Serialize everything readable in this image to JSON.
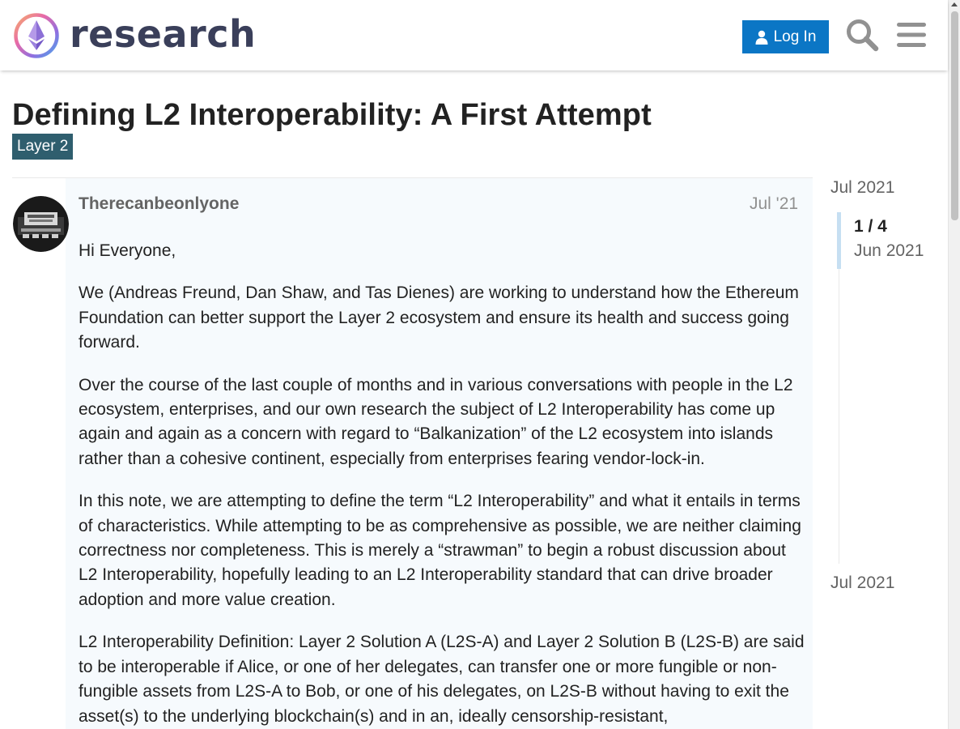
{
  "header": {
    "logo_text": "research",
    "login_label": "Log In",
    "colors": {
      "login_bg": "#0b76c5",
      "logo_text": "#3a3f5a"
    }
  },
  "topic": {
    "title": "Defining L2 Interoperability: A First Attempt",
    "category": "Layer 2",
    "category_color": "#2f5e6e"
  },
  "post": {
    "username": "Therecanbeonlyone",
    "date": "Jul '21",
    "paragraphs": [
      "Hi Everyone,",
      "We (Andreas Freund, Dan Shaw, and Tas Dienes) are working to understand how the Ethereum Foundation can better support the Layer 2 ecosystem and ensure its health and success going forward.",
      "Over the course of the last couple of months and in various conversations with people in the L2 ecosystem, enterprises, and our own research the subject of L2 Interoperability has come up again and again as a concern with regard to “Balkanization” of the L2 ecosystem into islands rather than a cohesive continent, especially from enterprises fearing vendor-lock-in.",
      "In this note, we are attempting to define the term “L2 Interoperability” and what it entails in terms of characteristics. While attempting to be as comprehensive as possible, we are neither claiming correctness nor completeness. This is merely a “strawman” to begin a robust discussion about L2 Interoperability, hopefully leading to an L2 Interoperability standard that can drive broader adoption and more value creation.",
      "L2 Interoperability Definition: Layer 2 Solution A (L2S-A) and Layer 2 Solution B (L2S-B) are said to be interoperable if Alice, or one of her delegates, can transfer one or more fungible or non-fungible assets from L2S-A to Bob, or one of his delegates, on L2S-B without having to exit the asset(s) to the underlying blockchain(s) and in an, ideally censorship-resistant,"
    ]
  },
  "timeline": {
    "top_date": "Jul 2021",
    "position": "1 / 4",
    "current_date": "Jun 2021",
    "bottom_date": "Jul 2021"
  },
  "icons": {
    "logo": "ethereum-research-logo-icon",
    "login": "user-icon",
    "search": "search-icon",
    "menu": "hamburger-menu-icon",
    "avatar": "user-avatar"
  }
}
